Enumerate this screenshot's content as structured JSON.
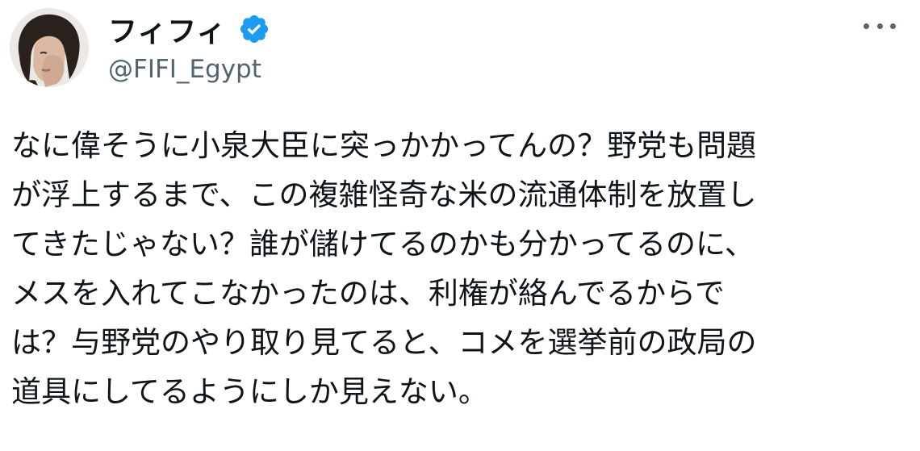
{
  "author": {
    "display_name": "フィフィ",
    "handle": "@FIFI_Egypt",
    "verified": true
  },
  "colors": {
    "verified_badge": "#1d9bf0",
    "text_primary": "#0f1419",
    "text_secondary": "#536471"
  },
  "icons": {
    "verified": "verified-badge-icon",
    "more": "more-options-icon"
  },
  "tweet": {
    "lines": [
      "なに偉そうに小泉大臣に突っかかってんの？野党も問題",
      "が浮上するまで、この複雑怪奇な米の流通体制を放置し",
      "てきたじゃない？誰が儲けてるのかも分かってるのに、",
      "メスを入れてこなかったのは、利権が絡んでるからで",
      "は？与野党のやり取り見てると、コメを選挙前の政局の",
      "道具にしてるようにしか見えない。"
    ]
  }
}
